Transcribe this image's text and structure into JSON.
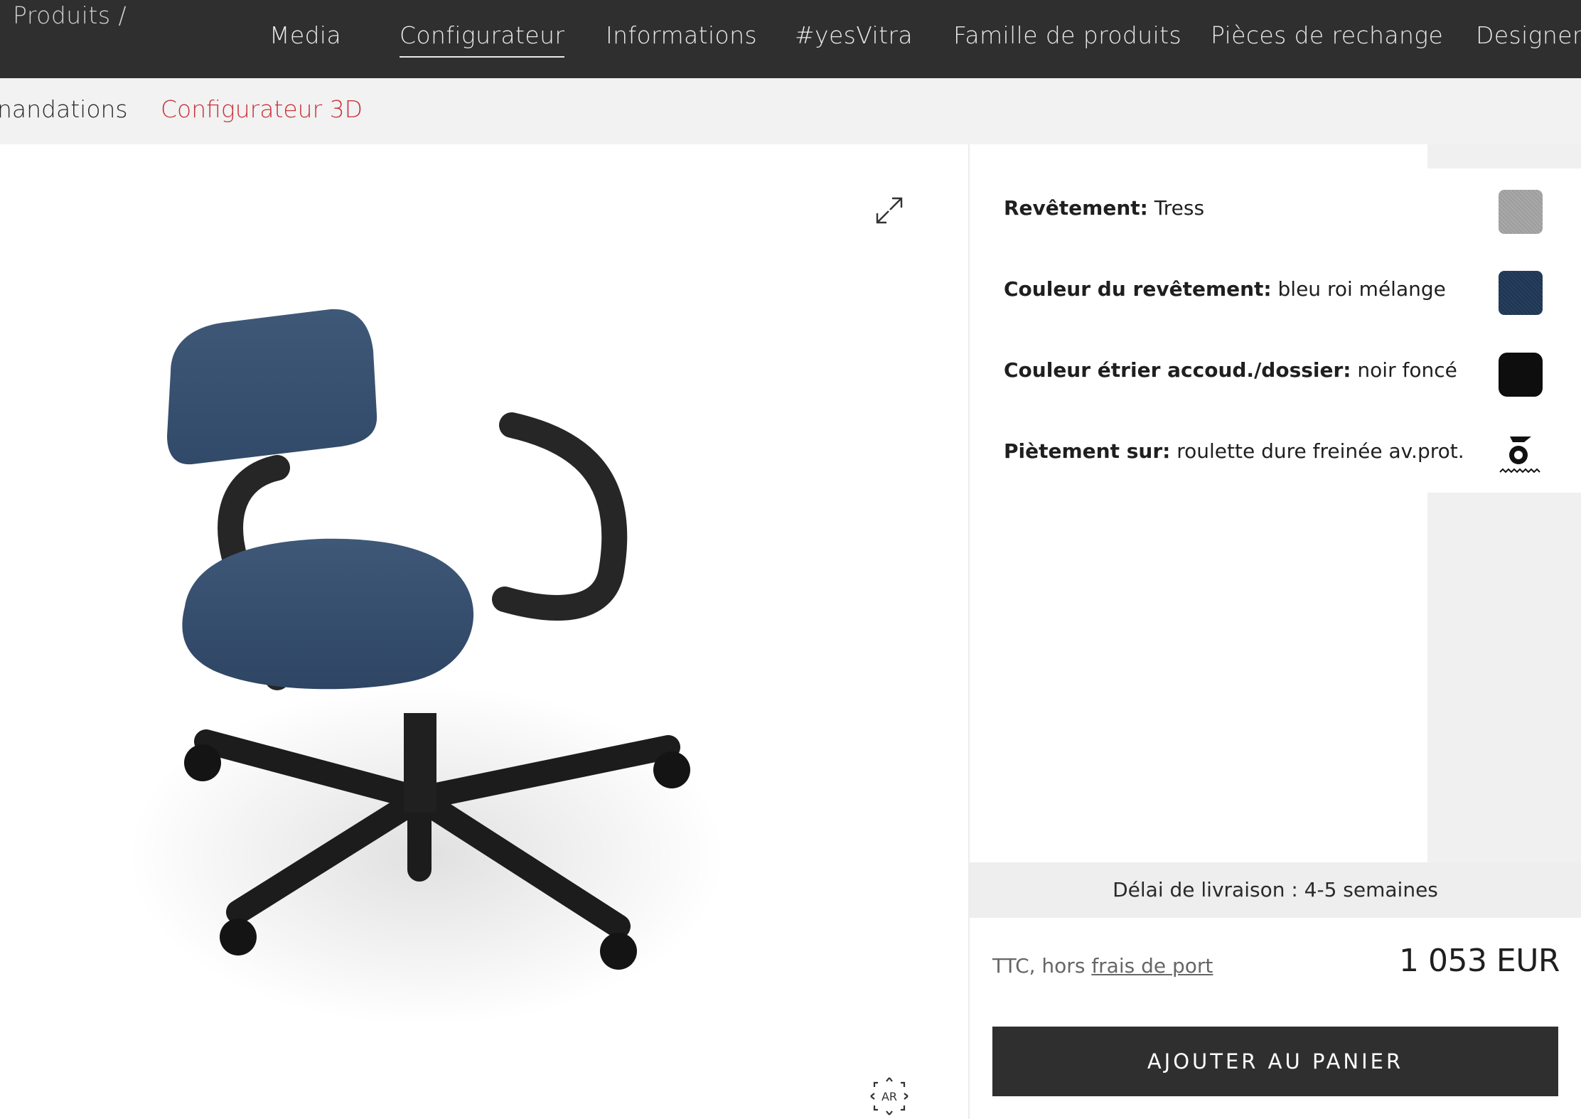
{
  "nav": {
    "breadcrumb": "Produits /",
    "items": [
      {
        "label": "Media"
      },
      {
        "label": "Configurateur"
      },
      {
        "label": "Informations"
      },
      {
        "label": "#yesVitra"
      },
      {
        "label": "Famille de produits"
      },
      {
        "label": "Pièces de rechange"
      },
      {
        "label": "Designer"
      }
    ],
    "active": "Configurateur"
  },
  "subnav": {
    "items": [
      {
        "label": "nandations"
      },
      {
        "label": "Configurateur 3D"
      }
    ],
    "active": "Configurateur 3D",
    "accent_color": "#c8323a"
  },
  "viewer": {
    "icons": [
      "expand-icon",
      "ar-icon"
    ],
    "ar_label": "AR"
  },
  "options": [
    {
      "label": "Revêtement:",
      "value": "Tress",
      "swatch": "grey-fabric",
      "swatch_color": "#a3a3a3"
    },
    {
      "label": "Couleur du revêtement:",
      "value": "bleu roi mélange",
      "swatch": "blue-fabric",
      "swatch_color": "#223a57"
    },
    {
      "label": "Couleur étrier accoud./dossier:",
      "value": "noir foncé",
      "swatch": "black",
      "swatch_color": "#0e0e0e"
    },
    {
      "label": "Piètement sur:",
      "value": "roulette dure freinée av.prot.",
      "swatch": "caster-icon"
    }
  ],
  "delivery": {
    "text": "Délai de livraison : 4-5 semaines"
  },
  "pricing": {
    "note_prefix": "TTC, hors",
    "note_link": "frais de port",
    "price": "1 053 EUR"
  },
  "cart": {
    "label": "AJOUTER AU PANIER"
  }
}
